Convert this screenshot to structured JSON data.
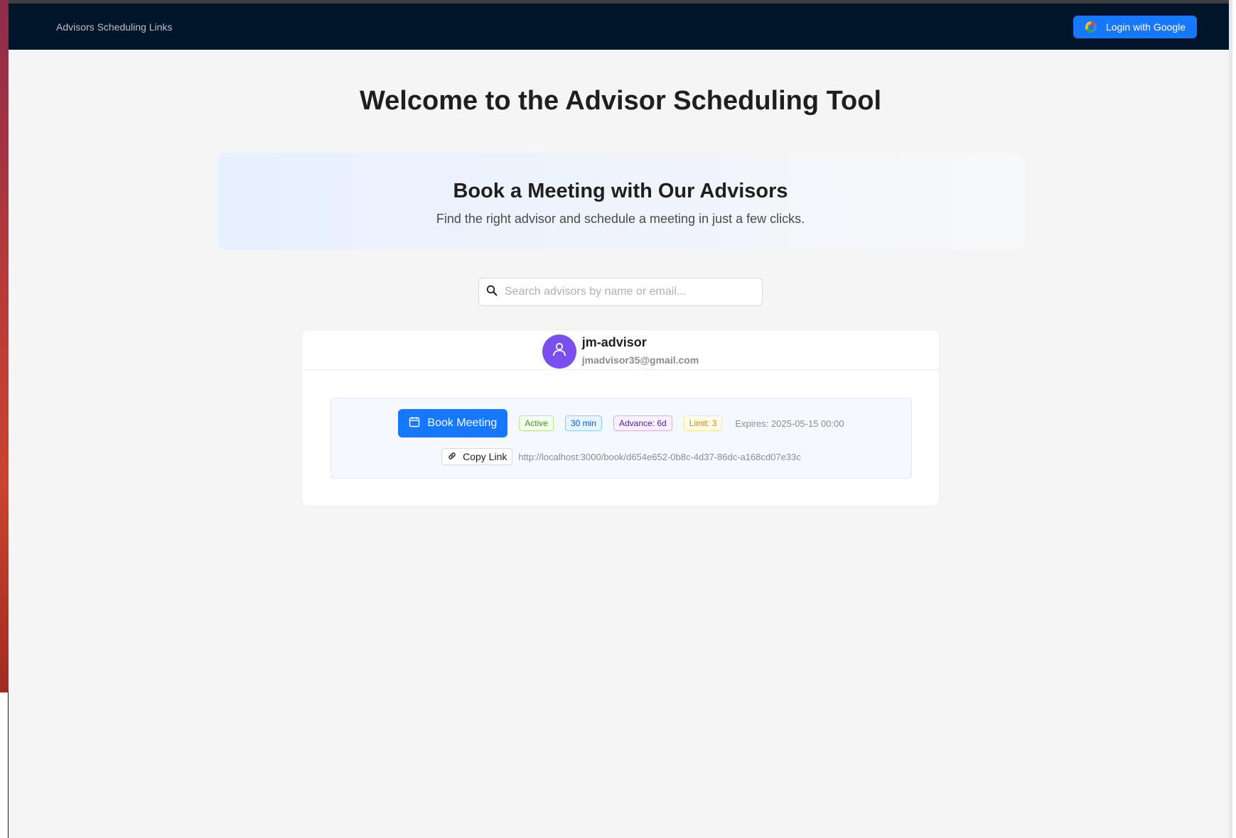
{
  "nav": {
    "brand": "Advisors Scheduling Links",
    "login_label": "Login with Google",
    "login_icon": "google-icon"
  },
  "page": {
    "title": "Welcome to the Advisor Scheduling Tool"
  },
  "hero": {
    "heading": "Book a Meeting with Our Advisors",
    "subtext": "Find the right advisor and schedule a meeting in just a few clicks."
  },
  "search": {
    "placeholder": "Search advisors by name or email...",
    "value": "",
    "icon": "search-icon"
  },
  "advisor": {
    "name": "jm-advisor",
    "email": "jmadvisor35@gmail.com",
    "avatar_icon": "user-icon",
    "link": {
      "book_label": "Book Meeting",
      "book_icon": "calendar-icon",
      "status": "Active",
      "duration": "30 min",
      "advance": "Advance: 6d",
      "limit": "Limit: 3",
      "expires": "Expires: 2025-05-15 00:00",
      "copy_label": "Copy Link",
      "copy_icon": "link-icon",
      "url": "http://localhost:3000/book/d654e652-0b8c-4d37-86dc-a168cd07e33c"
    }
  },
  "colors": {
    "navbar": "#001529",
    "primary": "#1677ff",
    "avatar": "#7a4ff0",
    "page_bg": "#f5f5f5"
  }
}
